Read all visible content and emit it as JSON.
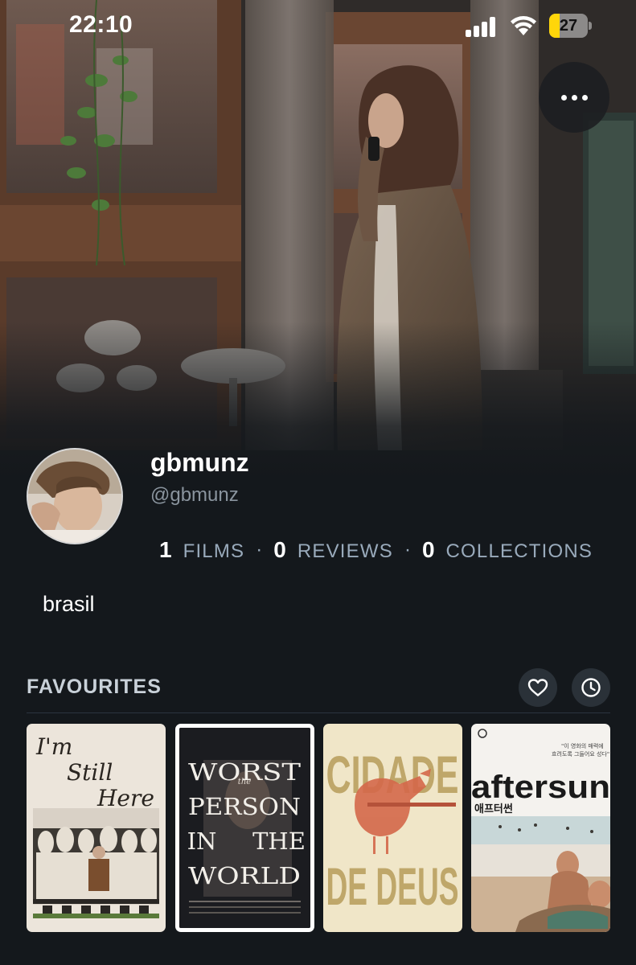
{
  "status_bar": {
    "time": "22:10",
    "battery_percent": 27,
    "battery_label": "27",
    "battery_color": "#ffd60a",
    "icons": [
      "signal-icon",
      "wifi-icon",
      "battery-icon"
    ]
  },
  "hero": {
    "more_button_icon": "ellipsis-icon"
  },
  "profile": {
    "display_name": "gbmunz",
    "handle": "@gbmunz",
    "stats": [
      {
        "value": "1",
        "label": "FILMS"
      },
      {
        "value": "0",
        "label": "REVIEWS"
      },
      {
        "value": "0",
        "label": "COLLECTIONS"
      }
    ],
    "separator": "·",
    "bio": "brasil"
  },
  "favourites": {
    "title": "FAVOURITES",
    "buttons": [
      "heart-icon",
      "clock-icon"
    ],
    "posters": [
      {
        "title": "I'm Still Here",
        "lines": [
          "I'm",
          "Still",
          "Here"
        ]
      },
      {
        "title": "The Worst Person in the World",
        "lines": [
          "WORST",
          "PERSON",
          "IN",
          "THE",
          "WORLD"
        ],
        "small_word": "the"
      },
      {
        "title": "Cidade de Deus",
        "lines": [
          "CIDADE",
          "DE DEUS"
        ]
      },
      {
        "title": "aftersun",
        "lines": [
          "aftersun"
        ],
        "subtitle": "애프터썬",
        "tagline_lines": [
          "\"이 영화의 매력에",
          "흐려도록 그들어요 성다\""
        ]
      }
    ]
  },
  "colors": {
    "background": "#14181c",
    "muted_text": "#99aabb",
    "accent_badge": "#ffd60a"
  }
}
